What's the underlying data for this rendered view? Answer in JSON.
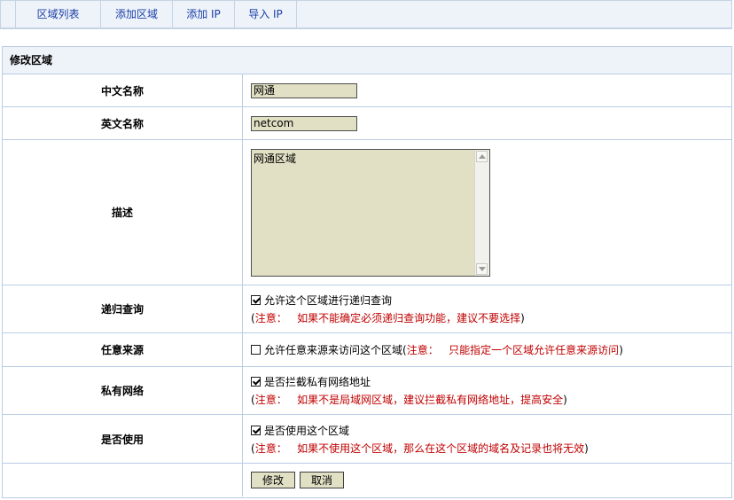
{
  "tabs": [
    {
      "label": "区域列表"
    },
    {
      "label": "添加区域"
    },
    {
      "label": "添加 IP"
    },
    {
      "label": "导入 IP"
    }
  ],
  "form": {
    "title": "修改区域",
    "cn_name": {
      "label": "中文名称",
      "value": "网通"
    },
    "en_name": {
      "label": "英文名称",
      "value": "netcom"
    },
    "desc": {
      "label": "描述",
      "value": "网通区域"
    },
    "recursion": {
      "label": "递归查询",
      "checked": true,
      "text": "允许这个区域进行递归查询",
      "note_prefix": "注意：",
      "note": "如果不能确定必须递归查询功能，建议不要选择"
    },
    "any_source": {
      "label": "任意来源",
      "checked": false,
      "text": "允许任意来源来访问这个区域",
      "note_prefix": "注意：",
      "note": "只能指定一个区域允许任意来源访问"
    },
    "private_net": {
      "label": "私有网络",
      "checked": true,
      "text": "是否拦截私有网络地址",
      "note_prefix": "注意：",
      "note": "如果不是局域网区域，建议拦截私有网络地址，提高安全"
    },
    "enabled": {
      "label": "是否使用",
      "checked": true,
      "text": "是否使用这个区域",
      "note_prefix": "注意：",
      "note": "如果不使用这个区域，那么在这个区域的域名及记录也将无效"
    },
    "buttons": {
      "modify": "修改",
      "cancel": "取消"
    }
  }
}
